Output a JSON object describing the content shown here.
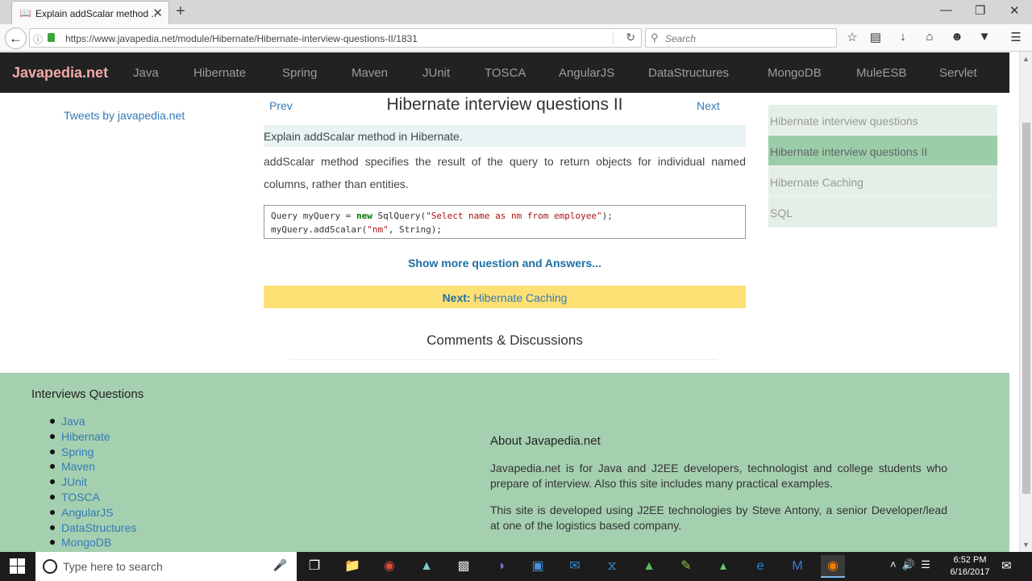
{
  "browser": {
    "tab_title": "Explain addScalar method ...",
    "url": "https://www.javapedia.net/module/Hibernate/Hibernate-interview-questions-II/1831",
    "search_placeholder": "Search"
  },
  "site": {
    "brand": "Javapedia.net",
    "nav": [
      "Java",
      "Hibernate",
      "Spring",
      "Maven",
      "JUnit",
      "TOSCA",
      "AngularJS",
      "DataStructures",
      "MongoDB",
      "MuleESB",
      "Servlet"
    ]
  },
  "sidebar_left": {
    "tweets": "Tweets by javapedia.net"
  },
  "content": {
    "prev": "Prev",
    "title": "Hibernate interview questions II",
    "next": "Next",
    "question": "Explain addScalar method in Hibernate.",
    "answer": "addScalar method specifies the result of the query to return objects for individual named columns, rather than entities.",
    "code_line1_a": "Query myQuery = ",
    "code_line1_kw": "new",
    "code_line1_b": " SqlQuery(",
    "code_line1_str": "\"Select name as nm from employee\"",
    "code_line1_c": ");",
    "code_line2_a": "myQuery.addScalar(",
    "code_line2_str": "\"nm\"",
    "code_line2_b": ", String);",
    "show_more": "Show more question and Answers...",
    "next_label": "Next:",
    "next_link": "Hibernate Caching",
    "comments": "Comments & Discussions"
  },
  "sidebar_right": {
    "items": [
      "Hibernate interview questions",
      "Hibernate interview questions II",
      "Hibernate Caching",
      "SQL"
    ],
    "active_index": 1
  },
  "footer": {
    "heading": "Interviews Questions",
    "links": [
      "Java",
      "Hibernate",
      "Spring",
      "Maven",
      "JUnit",
      "TOSCA",
      "AngularJS",
      "DataStructures",
      "MongoDB"
    ],
    "about_heading": "About Javapedia.net",
    "about_p1": "Javapedia.net is for Java and J2EE developers, technologist and college students who prepare of interview. Also this site includes many practical examples.",
    "about_p2": "This site is developed using J2EE technologies by Steve Antony, a senior Developer/lead at one of the logistics based company."
  },
  "taskbar": {
    "search_placeholder": "Type here to search",
    "time": "6:52 PM",
    "date": "6/16/2017"
  },
  "colors": {
    "nav_bg": "#222222",
    "brand": "#f2a8a8",
    "footer_bg": "#a5d0b0",
    "active_item": "#9bcda8",
    "next_bar": "#fde074",
    "link": "#337ab7"
  }
}
